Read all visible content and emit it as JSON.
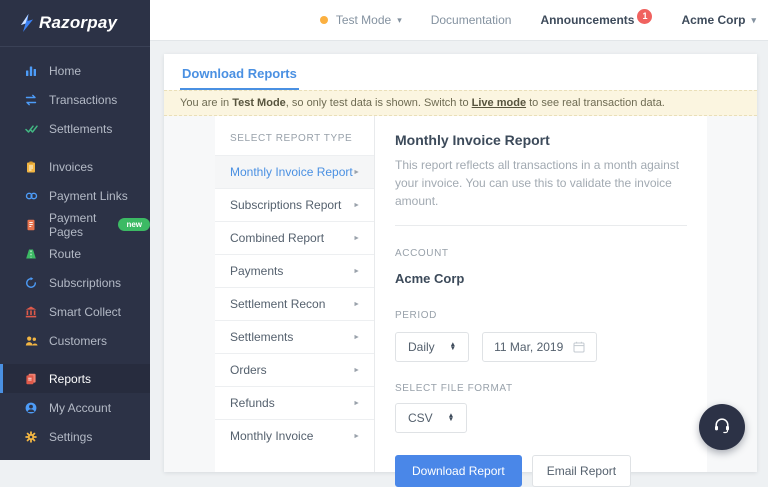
{
  "brand": {
    "name": "Razorpay"
  },
  "topbar": {
    "test_mode": {
      "label": "Test Mode",
      "caret": "▾",
      "dot_color": "#fbb040"
    },
    "documentation": {
      "label": "Documentation"
    },
    "announcements": {
      "label": "Announcements",
      "badge": "1",
      "badge_color": "#f0625f"
    },
    "account": {
      "label": "Acme Corp",
      "caret": "▾"
    }
  },
  "sidebar": {
    "items": [
      {
        "label": "Home",
        "icon": "home-icon"
      },
      {
        "label": "Transactions",
        "icon": "transactions-icon"
      },
      {
        "label": "Settlements",
        "icon": "settlements-icon"
      },
      {
        "label": "Invoices",
        "icon": "invoices-icon"
      },
      {
        "label": "Payment Links",
        "icon": "payment-links-icon"
      },
      {
        "label": "Payment Pages",
        "icon": "payment-pages-icon",
        "badge": "new"
      },
      {
        "label": "Route",
        "icon": "route-icon"
      },
      {
        "label": "Subscriptions",
        "icon": "subscriptions-icon"
      },
      {
        "label": "Smart Collect",
        "icon": "smart-collect-icon"
      },
      {
        "label": "Customers",
        "icon": "customers-icon"
      },
      {
        "label": "Reports",
        "icon": "reports-icon",
        "active": true
      },
      {
        "label": "My Account",
        "icon": "my-account-icon"
      },
      {
        "label": "Settings",
        "icon": "settings-icon"
      }
    ]
  },
  "tabs": {
    "download_reports": "Download Reports"
  },
  "banner": {
    "prefix": "You are in ",
    "bold": "Test Mode",
    "middle": ", so only test data is shown. Switch to ",
    "link": "Live mode",
    "suffix": " to see real transaction data."
  },
  "report_list": {
    "heading": "SELECT REPORT TYPE",
    "selected_index": 0,
    "items": [
      "Monthly Invoice Report",
      "Subscriptions Report",
      "Combined Report",
      "Payments",
      "Settlement Recon",
      "Settlements",
      "Orders",
      "Refunds",
      "Monthly Invoice"
    ],
    "row_arrow": "►"
  },
  "detail": {
    "title": "Monthly Invoice Report",
    "description": "This report reflects all transactions in a month against your invoice. You can use this to validate the invoice amount.",
    "account_label": "ACCOUNT",
    "account_value": "Acme Corp",
    "period_label": "PERIOD",
    "period_value": "Daily",
    "date_value": "11 Mar, 2019",
    "format_label": "SELECT FILE FORMAT",
    "format_value": "CSV",
    "download_button": "Download Report",
    "email_button": "Email Report"
  },
  "fab": {
    "icon": "headset-icon"
  },
  "colors": {
    "accent_blue": "#4a90e2",
    "sidebar_bg": "#2c3246",
    "banner_bg": "#fbf5e0",
    "page_bg": "#eef1f3",
    "new_badge_green": "#3cba64",
    "announcement_red": "#f0625f",
    "test_dot_yellow": "#fbb040"
  }
}
